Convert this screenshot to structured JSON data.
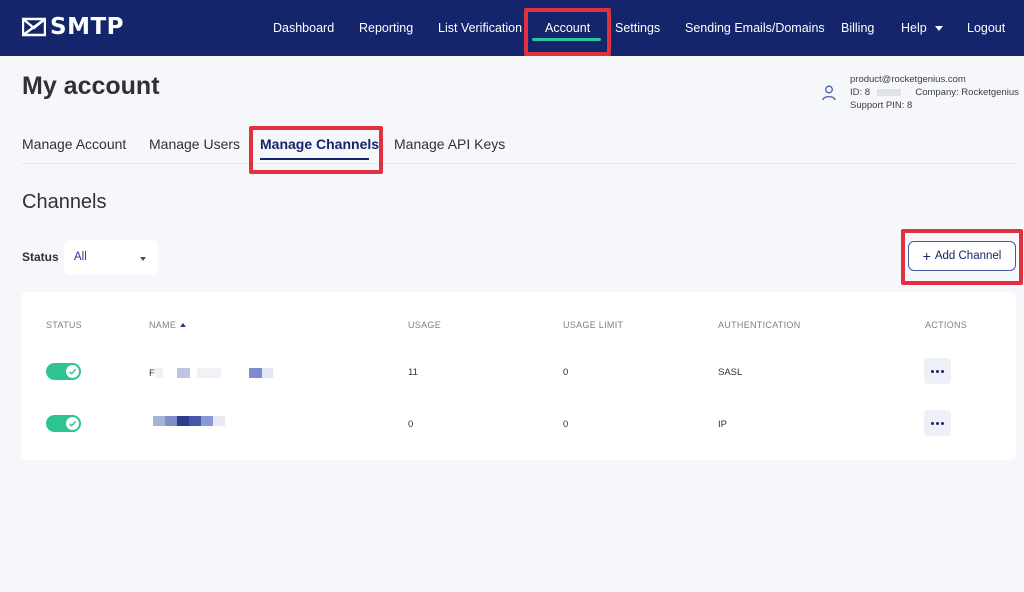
{
  "nav": {
    "logo_text": "SMTP",
    "items": [
      {
        "label": "Dashboard"
      },
      {
        "label": "Reporting"
      },
      {
        "label": "List Verification"
      },
      {
        "label": "Account"
      },
      {
        "label": "Settings"
      },
      {
        "label": "Sending Emails/Domains"
      },
      {
        "label": "Billing"
      },
      {
        "label": "Help"
      },
      {
        "label": "Logout"
      }
    ],
    "active": "Account"
  },
  "header": {
    "title": "My account",
    "user": {
      "email": "product@rocketgenius.com",
      "id_label": "ID: 8",
      "company_label": "Company:",
      "company": "Rocketgenius",
      "pin_label": "Support PIN: 8"
    }
  },
  "tabs": [
    {
      "label": "Manage Account"
    },
    {
      "label": "Manage Users"
    },
    {
      "label": "Manage Channels"
    },
    {
      "label": "Manage API Keys"
    }
  ],
  "active_tab": "Manage Channels",
  "section_title": "Channels",
  "filter": {
    "label": "Status",
    "value": "All"
  },
  "add_button": {
    "label": "Add Channel",
    "icon": "plus-icon"
  },
  "table": {
    "headers": [
      "STATUS",
      "NAME",
      "USAGE",
      "USAGE LIMIT",
      "AUTHENTICATION",
      "ACTIONS"
    ],
    "rows": [
      {
        "enabled": true,
        "name": "F",
        "usage": "11",
        "usage_limit": "0",
        "authentication": "SASL"
      },
      {
        "enabled": true,
        "name": "",
        "usage": "0",
        "usage_limit": "0",
        "authentication": "IP"
      }
    ]
  },
  "colors": {
    "nav_bg": "#14256b",
    "accent": "#29c79b",
    "highlight": "#e0323e",
    "toggle_on": "#2fc391"
  }
}
